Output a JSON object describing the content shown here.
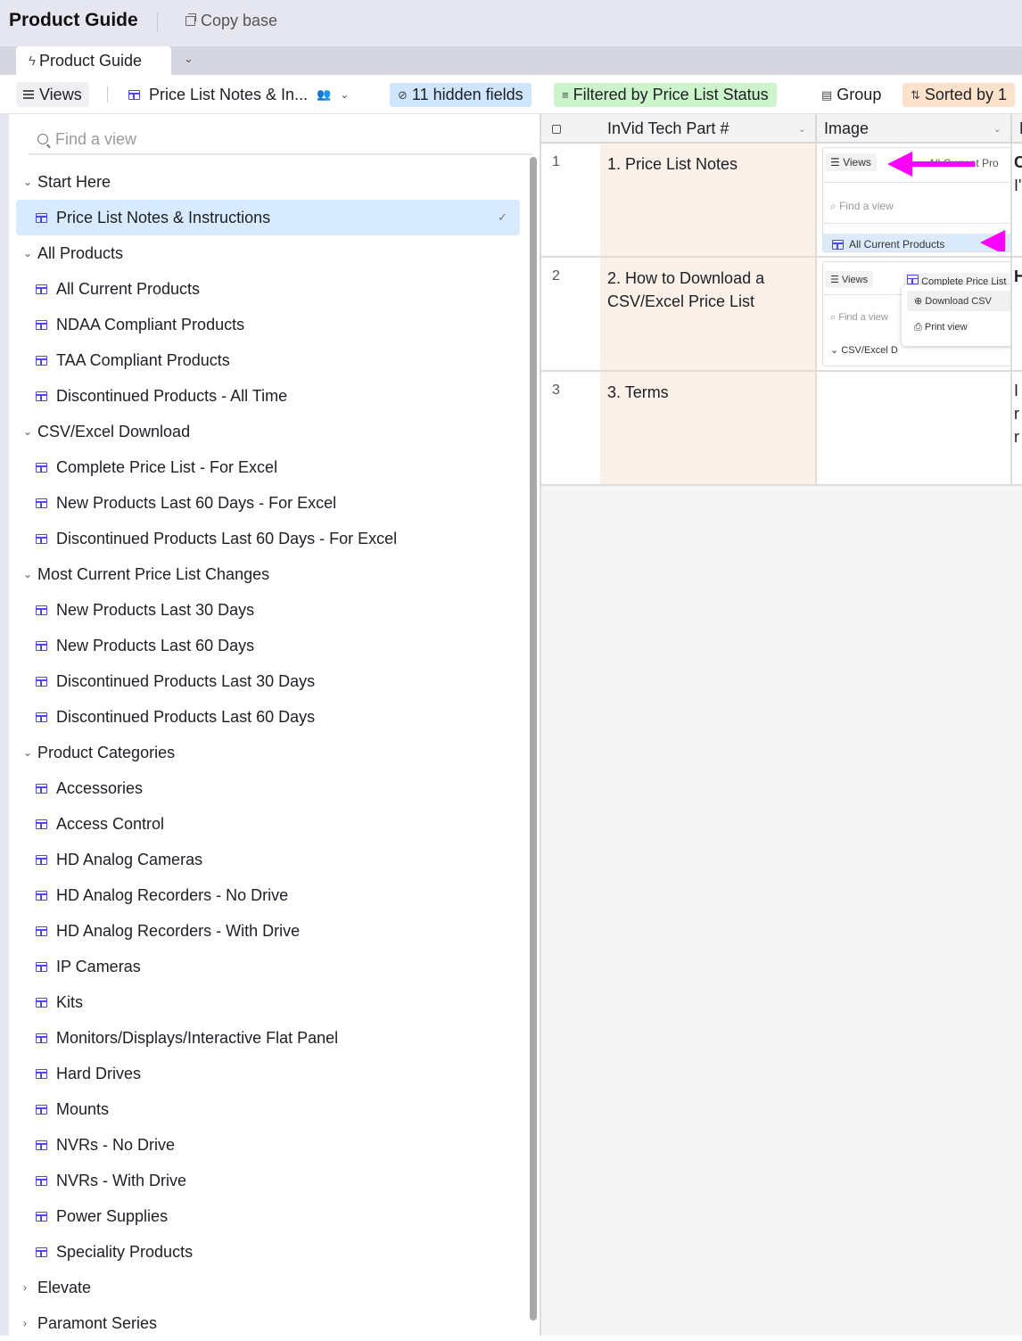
{
  "header": {
    "title": "Product Guide",
    "copy_base": "Copy base"
  },
  "tabs": [
    {
      "label": "Product Guide",
      "icon": "bolt-icon"
    }
  ],
  "toolbar": {
    "views_label": "Views",
    "current_view": "Price List Notes & In...",
    "hidden_fields": "11 hidden fields",
    "filter": "Filtered by Price List Status",
    "group": "Group",
    "sort": "Sorted by 1",
    "colors": {
      "hidden": "#cfe5fc",
      "filter": "#cdf5cc",
      "sort": "#fde2cb"
    }
  },
  "sidebar": {
    "search_placeholder": "Find a view",
    "sections": [
      {
        "title": "Start Here",
        "expanded": true,
        "items": [
          "Price List Notes & Instructions"
        ]
      },
      {
        "title": "All Products",
        "expanded": true,
        "items": [
          "All Current Products",
          "NDAA Compliant Products",
          "TAA Compliant Products",
          "Discontinued Products - All Time"
        ]
      },
      {
        "title": "CSV/Excel Download",
        "expanded": true,
        "items": [
          "Complete Price List - For Excel",
          "New Products Last 60 Days - For Excel",
          "Discontinued Products Last 60 Days - For Excel"
        ]
      },
      {
        "title": "Most Current Price List Changes",
        "expanded": true,
        "items": [
          "New Products Last 30 Days",
          "New Products Last 60 Days",
          "Discontinued Products Last 30 Days",
          "Discontinued Products Last 60 Days"
        ]
      },
      {
        "title": "Product Categories",
        "expanded": true,
        "items": [
          "Accessories",
          "Access Control",
          "HD Analog Cameras",
          "HD Analog Recorders - No Drive",
          "HD Analog Recorders - With Drive",
          "IP Cameras",
          "Kits",
          "Monitors/Displays/Interactive Flat Panel",
          "Hard Drives",
          "Mounts",
          "NVRs - No Drive",
          "NVRs - With Drive",
          "Power Supplies",
          "Speciality Products"
        ]
      },
      {
        "title": "Elevate",
        "expanded": false,
        "items": []
      },
      {
        "title": "Paramont Series",
        "expanded": false,
        "items": []
      }
    ],
    "active_view": "Price List Notes & Instructions"
  },
  "grid": {
    "columns": [
      "InVid Tech Part #",
      "Image",
      "D"
    ],
    "rows": [
      {
        "num": "1",
        "part": "1. Price List Notes",
        "d": [
          "C",
          "I'"
        ],
        "thumb": {
          "views": "Views",
          "tab": "All Current Pro",
          "find": "Find a view",
          "item": "All Current Products"
        }
      },
      {
        "num": "2",
        "part": "2. How to Download a CSV/Excel Price List",
        "d": [
          "H"
        ],
        "thumb": {
          "views": "Views",
          "tab": "Complete Price List",
          "find": "Find a view",
          "section": "CSV/Excel D",
          "menu": [
            "Download CSV",
            "Print view"
          ]
        }
      },
      {
        "num": "3",
        "part": "3. Terms",
        "d": [
          "I",
          "r",
          "r"
        ]
      }
    ]
  }
}
